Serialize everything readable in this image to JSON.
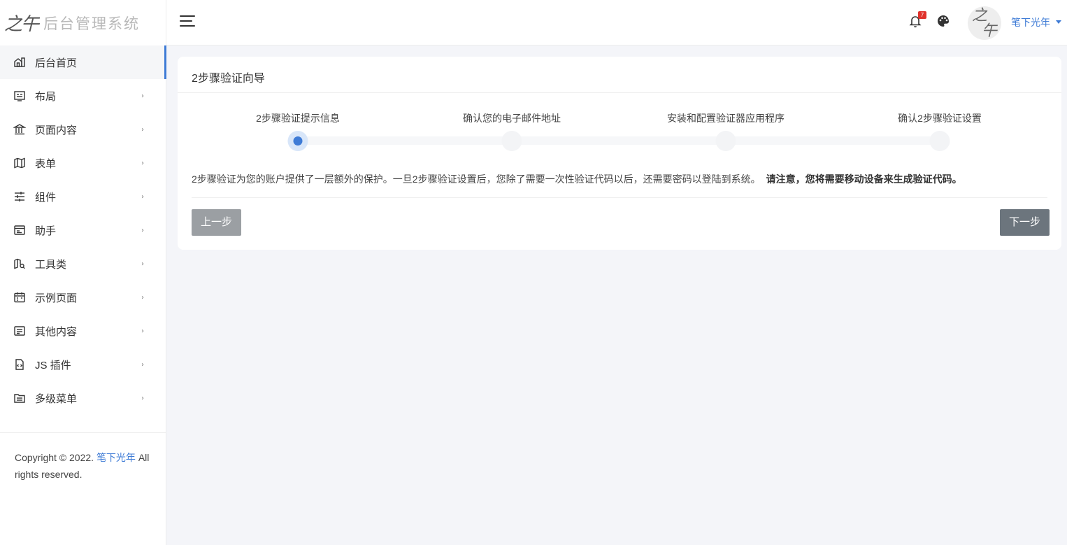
{
  "brand": {
    "mark": "之午",
    "name": "后台管理系统"
  },
  "sidebar": {
    "items": [
      {
        "label": "后台首页",
        "icon": "home-building-icon",
        "active": true,
        "has_children": false
      },
      {
        "label": "布局",
        "icon": "layout-icon",
        "active": false,
        "has_children": true
      },
      {
        "label": "页面内容",
        "icon": "bank-icon",
        "active": false,
        "has_children": true
      },
      {
        "label": "表单",
        "icon": "map-icon",
        "active": false,
        "has_children": true
      },
      {
        "label": "组件",
        "icon": "sliders-icon",
        "active": false,
        "has_children": true
      },
      {
        "label": "助手",
        "icon": "browser-icon",
        "active": false,
        "has_children": true
      },
      {
        "label": "工具类",
        "icon": "map-search-icon",
        "active": false,
        "has_children": true
      },
      {
        "label": "示例页面",
        "icon": "calendar-icon",
        "active": false,
        "has_children": true
      },
      {
        "label": "其他内容",
        "icon": "message-square-icon",
        "active": false,
        "has_children": true
      },
      {
        "label": "JS 插件",
        "icon": "file-code-icon",
        "active": false,
        "has_children": true
      },
      {
        "label": "多级菜单",
        "icon": "folder-icon",
        "active": false,
        "has_children": true
      }
    ],
    "arrow": "›",
    "copyright": {
      "prefix": "Copyright © 2022. ",
      "link": "笔下光年",
      "suffix": " All rights reserved."
    }
  },
  "header": {
    "notification_count": "7",
    "username": "笔下光年",
    "avatar_text": [
      "之",
      "午"
    ]
  },
  "wizard": {
    "title": "2步骤验证向导",
    "steps": [
      {
        "label": "2步骤验证提示信息",
        "active": true
      },
      {
        "label": "确认您的电子邮件地址",
        "active": false
      },
      {
        "label": "安装和配置验证器应用程序",
        "active": false
      },
      {
        "label": "确认2步骤验证设置",
        "active": false
      }
    ],
    "description": "2步骤验证为您的账户提供了一层额外的保护。一旦2步骤验证设置后，您除了需要一次性验证代码以后，还需要密码以登陆到系统。",
    "notice": "请注意，您将需要移动设备来生成验证代码。",
    "prev_label": "上一步",
    "next_label": "下一步"
  },
  "colors": {
    "accent": "#3e7bd6",
    "badge": "#e0322c",
    "btn_prev": "#9b9fa3",
    "btn_next": "#6c757d",
    "background": "#f4f5f9"
  }
}
